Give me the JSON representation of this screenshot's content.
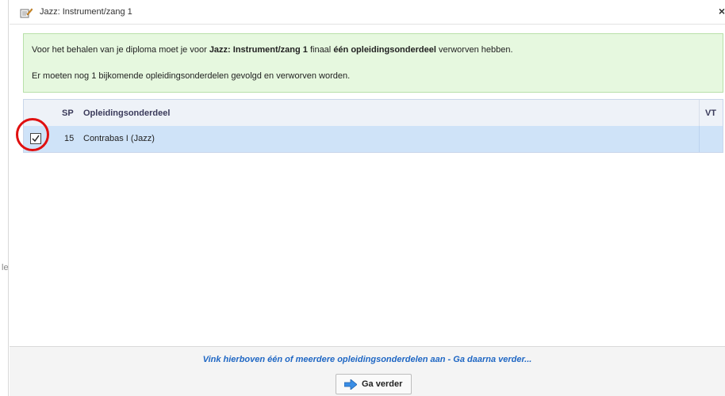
{
  "dialog": {
    "title": "Jazz: Instrument/zang 1",
    "close_label": "×"
  },
  "info": {
    "line1": {
      "prefix": "Voor het behalen van je diploma moet je voor ",
      "bold1": "Jazz: Instrument/zang 1",
      "middle": " finaal ",
      "bold2": "één opleidingsonderdeel",
      "suffix": " verworven hebben."
    },
    "line2": "Er moeten nog 1 bijkomende opleidingsonderdelen gevolgd en verworven worden."
  },
  "table": {
    "headers": {
      "sp": "SP",
      "name": "Opleidingsonderdeel",
      "vt": "VT"
    },
    "rows": [
      {
        "checked": true,
        "sp": "15",
        "name": "Contrabas I (Jazz)",
        "vt": ""
      }
    ]
  },
  "footer": {
    "hint": "Vink hierboven één of meerdere opleidingsonderdelen aan - Ga daarna verder...",
    "button_label": "Ga verder"
  },
  "left_strip": {
    "mark": "le"
  },
  "colors": {
    "info_bg": "#e6f8df",
    "row_selected": "#cfe3f8",
    "hint": "#1f67c4",
    "annotation": "#e01010"
  }
}
